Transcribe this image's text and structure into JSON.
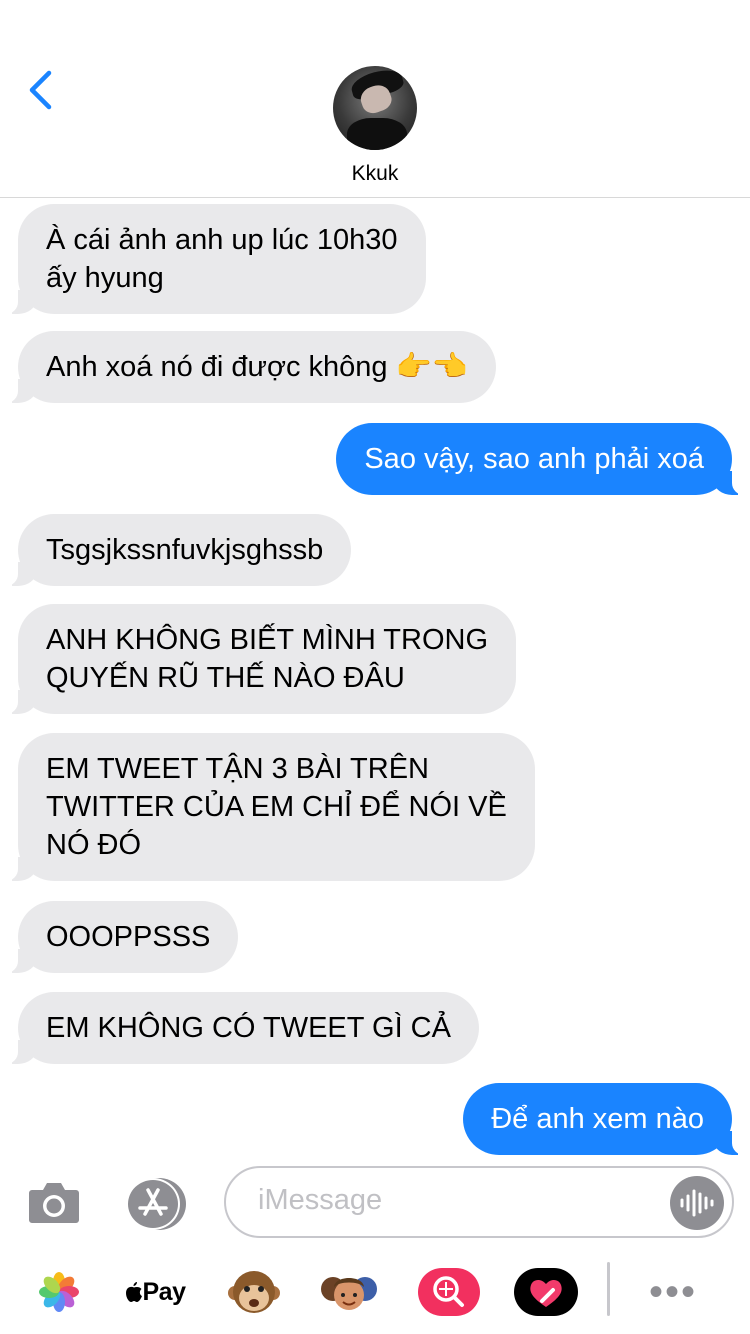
{
  "status": {
    "battery_color": "#f7d21a"
  },
  "header": {
    "contact_name": "Kkuk",
    "back_icon": "chevron-left-icon",
    "accent": "#1a84ff"
  },
  "messages": [
    {
      "from": "them",
      "text": "À cái ảnh anh up lúc 10h30\nấy hyung"
    },
    {
      "from": "them",
      "text": "Anh xoá nó đi được không 👉👈"
    },
    {
      "from": "me",
      "text": "Sao vậy, sao anh phải xoá"
    },
    {
      "from": "them",
      "text": "Tsgsjkssnfuvkjsghssb"
    },
    {
      "from": "them",
      "text": "ANH KHÔNG BIẾT MÌNH TRONG\nQUYẾN RŨ THẾ NÀO ĐÂU"
    },
    {
      "from": "them",
      "text": "EM TWEET TẬN 3 BÀI TRÊN\nTWITTER CỦA EM CHỈ ĐỂ NÓI VỀ\nNÓ ĐÓ"
    },
    {
      "from": "them",
      "text": "OOOPPSSS"
    },
    {
      "from": "them",
      "text": "EM KHÔNG CÓ TWEET GÌ CẢ"
    },
    {
      "from": "me",
      "text": "Để anh xem nào"
    }
  ],
  "composer": {
    "placeholder": "iMessage"
  },
  "app_drawer": {
    "apple_pay_label": "Pay"
  }
}
